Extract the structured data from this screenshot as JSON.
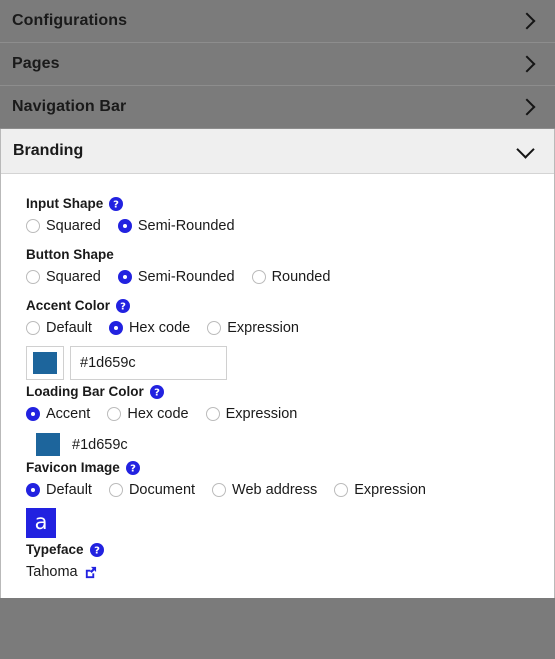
{
  "accent_blue": "#2222e0",
  "brand_color": "#1d659c",
  "sections": [
    {
      "label": "Configurations",
      "state": "collapsed",
      "icon": "chevron-right-icon"
    },
    {
      "label": "Pages",
      "state": "collapsed",
      "icon": "chevron-right-icon"
    },
    {
      "label": "Navigation Bar",
      "state": "collapsed",
      "icon": "chevron-right-icon"
    }
  ],
  "branding": {
    "label": "Branding",
    "state": "expanded",
    "icon": "chevron-down-icon",
    "fields": {
      "input_shape": {
        "label": "Input Shape",
        "help": "help-icon",
        "options": [
          {
            "label": "Squared",
            "selected": false
          },
          {
            "label": "Semi-Rounded",
            "selected": true
          }
        ]
      },
      "button_shape": {
        "label": "Button Shape",
        "help": null,
        "options": [
          {
            "label": "Squared",
            "selected": false
          },
          {
            "label": "Semi-Rounded",
            "selected": true
          },
          {
            "label": "Rounded",
            "selected": false
          }
        ]
      },
      "accent_color": {
        "label": "Accent Color",
        "help": "help-icon",
        "options": [
          {
            "label": "Default",
            "selected": false
          },
          {
            "label": "Hex code",
            "selected": true
          },
          {
            "label": "Expression",
            "selected": false
          }
        ],
        "swatch": "#1d659c",
        "value": "#1d659c",
        "placeholder": ""
      },
      "loading_bar_color": {
        "label": "Loading Bar Color",
        "help": "help-icon",
        "options": [
          {
            "label": "Accent",
            "selected": true
          },
          {
            "label": "Hex code",
            "selected": false
          },
          {
            "label": "Expression",
            "selected": false
          }
        ],
        "swatch": "#1d659c",
        "value": "#1d659c"
      },
      "favicon_image": {
        "label": "Favicon Image",
        "help": "help-icon",
        "options": [
          {
            "label": "Default",
            "selected": true
          },
          {
            "label": "Document",
            "selected": false
          },
          {
            "label": "Web address",
            "selected": false
          },
          {
            "label": "Expression",
            "selected": false
          }
        ],
        "preview_glyph": "a"
      },
      "typeface": {
        "label": "Typeface",
        "help": "help-icon",
        "value": "Tahoma",
        "link_icon": "external-link-icon"
      }
    }
  }
}
